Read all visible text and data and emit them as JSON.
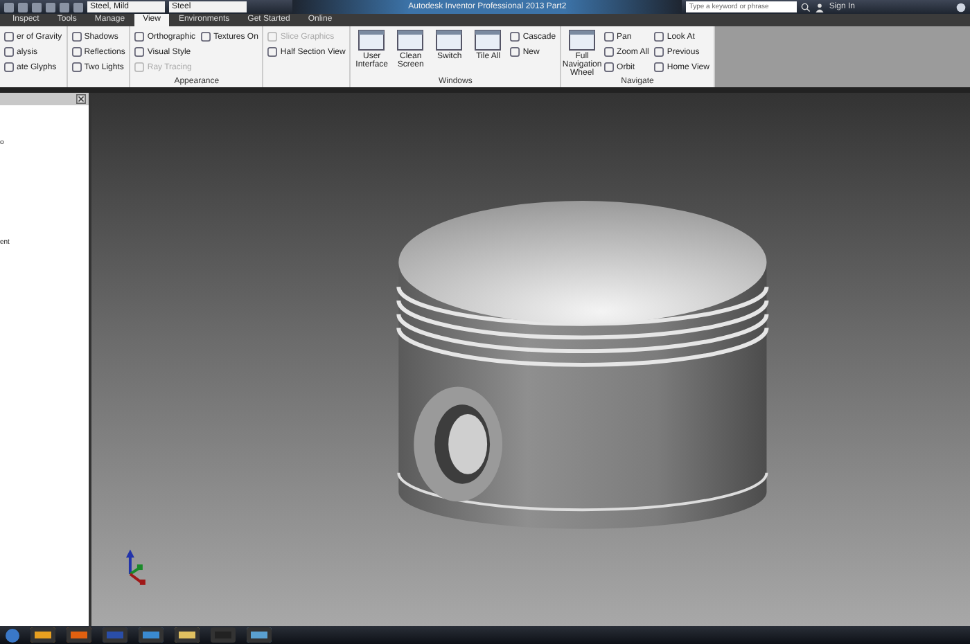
{
  "title_bar": {
    "material": "Steel, Mild",
    "appearance": "Steel",
    "title": "Autodesk Inventor Professional 2013   Part2",
    "search": {
      "placeholder": "Type a keyword or phrase"
    },
    "sign_in": "Sign In"
  },
  "tabs": [
    {
      "label": "Inspect",
      "selected": false
    },
    {
      "label": "Tools",
      "selected": false
    },
    {
      "label": "Manage",
      "selected": false
    },
    {
      "label": "View",
      "selected": true
    },
    {
      "label": "Environments",
      "selected": false
    },
    {
      "label": "Get Started",
      "selected": false
    },
    {
      "label": "Online",
      "selected": false
    }
  ],
  "ribbon": [
    {
      "items": [
        {
          "kind": "small",
          "label": "er of Gravity",
          "disabled": false
        },
        {
          "kind": "small",
          "label": "alysis",
          "disabled": false
        },
        {
          "kind": "small",
          "label": "ate Glyphs",
          "disabled": false
        }
      ]
    },
    {
      "items": [
        {
          "kind": "small",
          "label": "Shadows",
          "disabled": false
        },
        {
          "kind": "small",
          "label": "Reflections",
          "disabled": false
        },
        {
          "kind": "small",
          "label": "Two Lights",
          "disabled": false
        }
      ]
    },
    {
      "label": "Appearance",
      "items": [
        {
          "kind": "small",
          "label": "Orthographic",
          "disabled": false
        },
        {
          "kind": "small",
          "label": "Visual Style",
          "disabled": false
        },
        {
          "kind": "small",
          "label": "Ray Tracing",
          "disabled": true
        },
        {
          "kind": "small",
          "label": "Textures On",
          "disabled": false
        }
      ]
    },
    {
      "items": [
        {
          "kind": "small",
          "label": "Slice Graphics",
          "disabled": true
        },
        {
          "kind": "small",
          "label": "Half Section View",
          "disabled": false
        }
      ]
    },
    {
      "label": "Windows",
      "items": [
        {
          "kind": "large",
          "label": "User Interface",
          "disabled": false
        },
        {
          "kind": "large",
          "label": "Clean Screen",
          "disabled": false
        },
        {
          "kind": "large",
          "label": "Switch",
          "disabled": false
        },
        {
          "kind": "large",
          "label": "Tile All",
          "disabled": false
        },
        {
          "kind": "small",
          "label": "Cascade",
          "disabled": false
        },
        {
          "kind": "small",
          "label": "New",
          "disabled": false
        }
      ]
    },
    {
      "label": "Navigate",
      "items": [
        {
          "kind": "large",
          "label": "Full Navigation Wheel",
          "disabled": false
        },
        {
          "kind": "small",
          "label": "Pan",
          "disabled": false
        },
        {
          "kind": "small",
          "label": "Zoom All",
          "disabled": false
        },
        {
          "kind": "small",
          "label": "Orbit",
          "disabled": false
        },
        {
          "kind": "small",
          "label": "Look At",
          "disabled": false
        },
        {
          "kind": "small",
          "label": "Previous",
          "disabled": false
        },
        {
          "kind": "small",
          "label": "Home View",
          "disabled": false
        }
      ]
    }
  ],
  "browser": {
    "lines": [
      "o",
      "ent"
    ]
  }
}
